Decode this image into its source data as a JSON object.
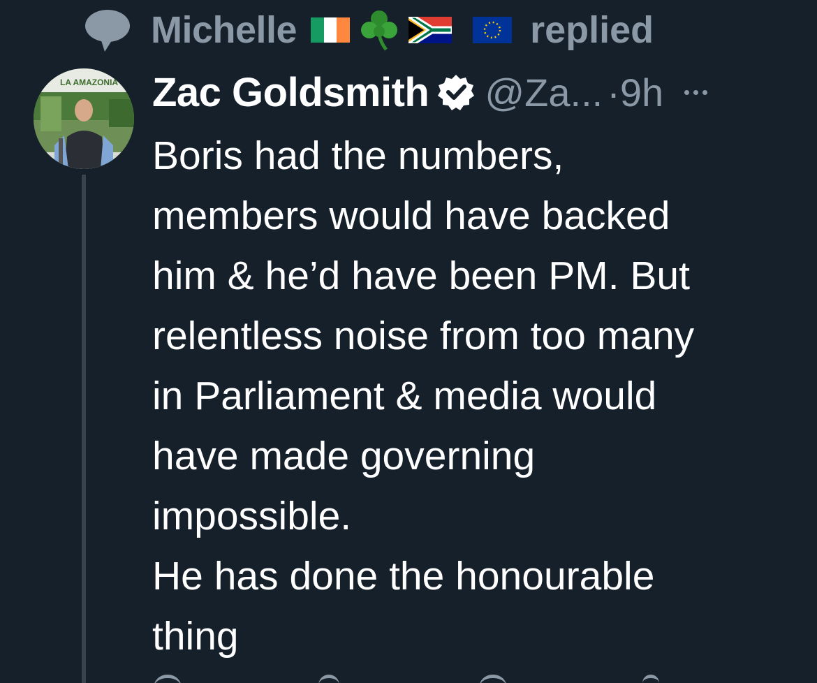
{
  "context": {
    "icon": "speech-bubble-icon",
    "name": "Michelle",
    "flags": [
      "ireland-flag",
      "shamrock",
      "south-africa-flag",
      "eu-flag"
    ],
    "action": "replied"
  },
  "tweet": {
    "author": "Zac Goldsmith",
    "verified": true,
    "handle": "@Za...",
    "separator": "·",
    "time": "9h",
    "more_icon": "more-horizontal-icon",
    "avatar_text": "LA AMAZONIA",
    "lines": [
      "Boris had the numbers,",
      "members would have backed",
      "him & he’d have been PM. But",
      "relentless noise from too many",
      "in Parliament & media would",
      "have made governing",
      "impossible.",
      "He has done the honourable",
      "thing"
    ]
  },
  "actions": [
    "reply-icon",
    "retweet-icon",
    "like-icon",
    "share-icon"
  ],
  "colors": {
    "background": "#15202b",
    "text": "#ffffff",
    "secondary": "#8b98a5",
    "thread_line": "#38444d"
  }
}
